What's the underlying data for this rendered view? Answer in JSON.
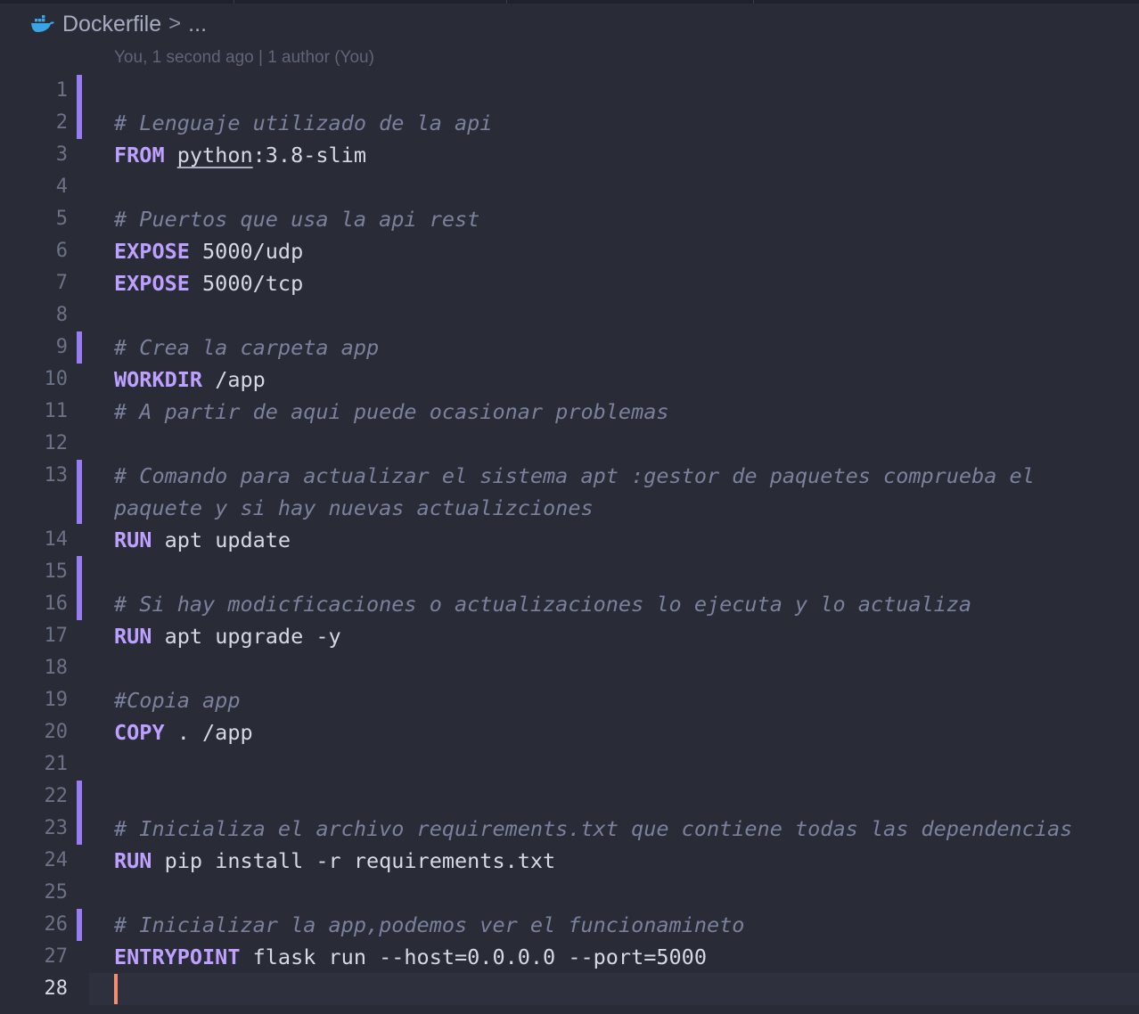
{
  "breadcrumb": {
    "file": "Dockerfile",
    "separator": ">",
    "more": "...",
    "icon": "docker-whale-icon",
    "icon_color": "#3aa5e4"
  },
  "blame": "You, 1 second ago | 1 author (You)",
  "colors": {
    "background": "#292c37",
    "keyword": "#bda0ff",
    "comment": "#7b819c",
    "text": "#d6d9e4",
    "git_modified_bar": "#9a7cf0",
    "cursor": "#f08e6f"
  },
  "editor": {
    "current_line": 28,
    "lines": [
      {
        "n": "1",
        "kw": "",
        "pre": "",
        "ul": "",
        "rest": "",
        "comment": "",
        "git": true
      },
      {
        "n": "2",
        "kw": "",
        "pre": "",
        "ul": "",
        "rest": "",
        "comment": "# Lenguaje utilizado de la api",
        "git": true
      },
      {
        "n": "3",
        "kw": "FROM",
        "pre": " ",
        "ul": "python",
        "rest": ":3.8-slim",
        "comment": "",
        "git": false
      },
      {
        "n": "4",
        "kw": "",
        "pre": "",
        "ul": "",
        "rest": "",
        "comment": "",
        "git": false
      },
      {
        "n": "5",
        "kw": "",
        "pre": "",
        "ul": "",
        "rest": "",
        "comment": "# Puertos que usa la api rest",
        "git": false
      },
      {
        "n": "6",
        "kw": "EXPOSE",
        "pre": "",
        "ul": "",
        "rest": " 5000/udp",
        "comment": "",
        "git": false
      },
      {
        "n": "7",
        "kw": "EXPOSE",
        "pre": "",
        "ul": "",
        "rest": " 5000/tcp",
        "comment": "",
        "git": false
      },
      {
        "n": "8",
        "kw": "",
        "pre": "",
        "ul": "",
        "rest": "",
        "comment": "",
        "git": false
      },
      {
        "n": "9",
        "kw": "",
        "pre": "",
        "ul": "",
        "rest": "",
        "comment": "# Crea la carpeta app",
        "git": true
      },
      {
        "n": "10",
        "kw": "WORKDIR",
        "pre": "",
        "ul": "",
        "rest": " /app",
        "comment": "",
        "git": false
      },
      {
        "n": "11",
        "kw": "",
        "pre": "",
        "ul": "",
        "rest": "",
        "comment": "# A partir de aqui puede ocasionar problemas",
        "git": false
      },
      {
        "n": "12",
        "kw": "",
        "pre": "",
        "ul": "",
        "rest": "",
        "comment": "",
        "git": false
      },
      {
        "n": "13",
        "kw": "",
        "pre": "",
        "ul": "",
        "rest": "",
        "comment": "# Comando para actualizar el sistema apt :gestor de paquetes comprueba el paquete y si hay nuevas actualizciones",
        "git": true,
        "wrap": true
      },
      {
        "n": "14",
        "kw": "RUN",
        "pre": "",
        "ul": "",
        "rest": " apt update",
        "comment": "",
        "git": false
      },
      {
        "n": "15",
        "kw": "",
        "pre": "",
        "ul": "",
        "rest": "",
        "comment": "",
        "git": true
      },
      {
        "n": "16",
        "kw": "",
        "pre": "",
        "ul": "",
        "rest": "",
        "comment": "# Si hay modicficaciones o actualizaciones lo ejecuta y lo actualiza",
        "git": true
      },
      {
        "n": "17",
        "kw": "RUN",
        "pre": "",
        "ul": "",
        "rest": " apt upgrade -y",
        "comment": "",
        "git": false
      },
      {
        "n": "18",
        "kw": "",
        "pre": "",
        "ul": "",
        "rest": "",
        "comment": "",
        "git": false
      },
      {
        "n": "19",
        "kw": "",
        "pre": "",
        "ul": "",
        "rest": "",
        "comment": "#Copia app",
        "git": false
      },
      {
        "n": "20",
        "kw": "COPY",
        "pre": "",
        "ul": "",
        "rest": " . /app",
        "comment": "",
        "git": false
      },
      {
        "n": "21",
        "kw": "",
        "pre": "",
        "ul": "",
        "rest": "",
        "comment": "",
        "git": false
      },
      {
        "n": "22",
        "kw": "",
        "pre": "",
        "ul": "",
        "rest": "",
        "comment": "",
        "git": true
      },
      {
        "n": "23",
        "kw": "",
        "pre": "",
        "ul": "",
        "rest": "",
        "comment": "# Inicializa el archivo requirements.txt que contiene todas las dependencias",
        "git": true
      },
      {
        "n": "24",
        "kw": "RUN",
        "pre": "",
        "ul": "",
        "rest": " pip install -r requirements.txt",
        "comment": "",
        "git": false
      },
      {
        "n": "25",
        "kw": "",
        "pre": "",
        "ul": "",
        "rest": "",
        "comment": "",
        "git": false
      },
      {
        "n": "26",
        "kw": "",
        "pre": "",
        "ul": "",
        "rest": "",
        "comment": "# Inicializar la app,podemos ver el funcionamineto",
        "git": true
      },
      {
        "n": "27",
        "kw": "ENTRYPOINT",
        "pre": "",
        "ul": "",
        "rest": " flask run --host=0.0.0.0 --port=5000",
        "comment": "",
        "git": false
      },
      {
        "n": "28",
        "kw": "",
        "pre": "",
        "ul": "",
        "rest": "",
        "comment": "",
        "git": false
      }
    ]
  }
}
